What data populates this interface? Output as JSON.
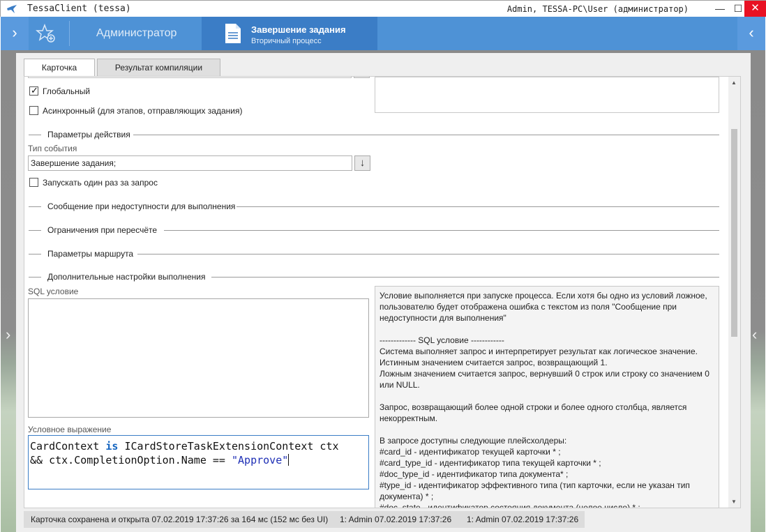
{
  "window": {
    "title": "TessaClient (tessa)",
    "user": "Admin, TESSA-PC\\User (администратор)",
    "minimize": "—",
    "maximize": "☐",
    "close": "✕"
  },
  "header": {
    "nav_left": "›",
    "nav_right": "‹",
    "favorites_icon": "star-plus-icon",
    "admin_tab": "Администратор",
    "active_tab_title": "Завершение задания",
    "active_tab_subtitle": "Вторичный процесс"
  },
  "side_arrows": {
    "left": "›",
    "right": "‹"
  },
  "tabs": [
    {
      "label": "Карточка",
      "active": true
    },
    {
      "label": "Результат компиляции",
      "active": false
    }
  ],
  "form": {
    "global_checkbox": {
      "label": "Глобальный",
      "checked": true
    },
    "async_checkbox": {
      "label": "Асинхронный (для этапов, отправляющих задания)",
      "checked": false
    },
    "group_action_params": "Параметры действия",
    "event_type_label": "Тип события",
    "event_type_value": "Завершение задания;",
    "event_type_button": "↓",
    "run_once_checkbox": {
      "label": "Запускать один раз за запрос",
      "checked": false
    },
    "group_unavailable_message": "Сообщение при недоступности для выполнения",
    "group_recalc_limits": "Ограничения при пересчёте",
    "group_route_params": "Параметры маршрута",
    "group_extra_settings": "Дополнительные настройки выполнения",
    "sql_condition_label": "SQL условие",
    "conditional_expression_label": "Условное выражение",
    "code": {
      "line1_a": "CardContext ",
      "line1_kw": "is",
      "line1_b": " ICardStoreTaskExtensionContext ctx",
      "line2_a": "&& ctx.CompletionOption.Name == ",
      "line2_str": "\"Approve\""
    },
    "help_text": "Условие выполняется при запуске процесса. Если хотя бы одно из условий ложное, пользователю будет отображена ошибка с текстом из поля \"Сообщение при недоступности для выполнения\"\n\n------------- SQL условие ------------\nСистема выполняет запрос и интерпретирует результат как логическое значение.\nИстинным значением считается запрос, возвращающий 1.\nЛожным значением считается запрос, вернувший 0 строк или строку со значением 0 или NULL.\n\nЗапрос, возвращающий более одной строки и более одного столбца, является некорректным.\n\nВ запросе доступны следующие плейсхолдеры:\n#card_id - идентификатор текущей карточки * ;\n#card_type_id - идентификатор типа текущей карточки * ;\n#doc_type_id - идентификатор типа документа* ;\n#type_id - идентификатор эффективного типа (тип карточки, если не указан тип документа) * ;\n#doc_state - идентификатор состояния документа (целое число) * ;"
  },
  "status_bar": {
    "message": "Карточка сохранена и открыта 07.02.2019 17:37:26 за 164 мс (152 мс без UI)",
    "entry1": "1:  Admin  07.02.2019 17:37:26",
    "entry2": "1:  Admin  07.02.2019 17:37:26"
  }
}
